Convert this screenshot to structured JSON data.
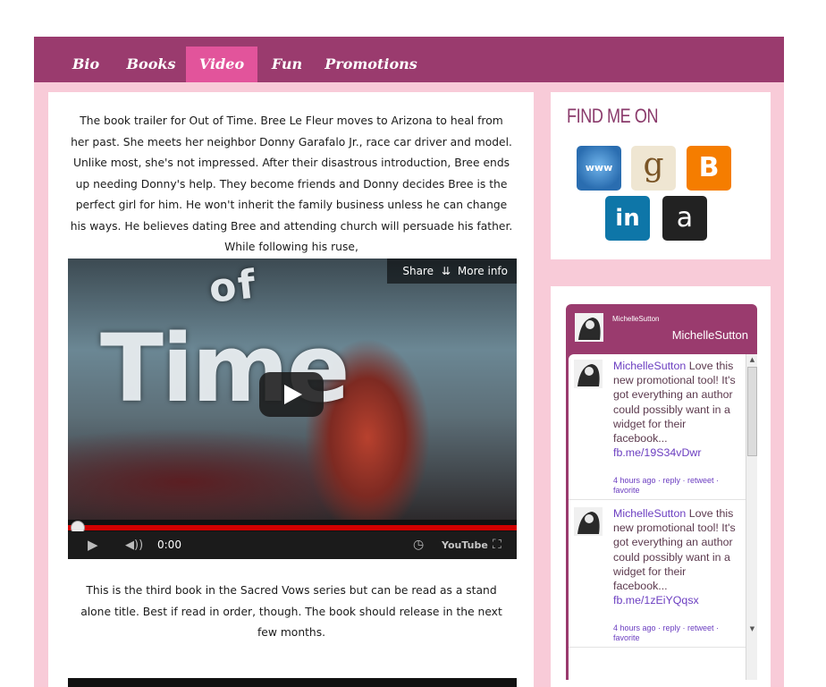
{
  "nav": {
    "items": [
      {
        "label": "Bio",
        "active": false
      },
      {
        "label": "Books",
        "active": false
      },
      {
        "label": "Video",
        "active": true
      },
      {
        "label": "Fun",
        "active": false
      },
      {
        "label": "Promotions",
        "active": false
      }
    ]
  },
  "main": {
    "intro_text": "The book trailer for Out of Time. Bree Le Fleur moves to Arizona to heal from her past. She meets her neighbor Donny Garafalo Jr., race car driver and model. Unlike most, she's not impressed. After their disastrous introduction, Bree ends up needing Donny's help. They become friends and Donny decides Bree is the perfect girl for him. He won't inherit the family business unless he can change his ways. He believes dating Bree and attending church will persuade his father. While following his ruse,",
    "video": {
      "title_line1": "of",
      "title_line2": "Time",
      "share_label": "Share",
      "more_info_label": "More info",
      "time": "0:00",
      "progress_fraction": 0.0,
      "logo_text": "YouTube"
    },
    "outro_text": "This is the third book in the Sacred Vows series but can be read as a stand alone title. Best if read in order, though. The book should release in the next few months."
  },
  "sidebar": {
    "find_title": "FIND ME ON",
    "social_icons": [
      "website-icon",
      "goodreads-icon",
      "blogger-icon",
      "linkedin-icon",
      "amazon-icon"
    ],
    "twitter": {
      "handle_small": "MichelleSutton",
      "handle_big": "MichelleSutton",
      "tweets": [
        {
          "user": "MichelleSutton",
          "text": "Love this new promotional tool! It's got everything an author could possibly want in a widget for their facebook...",
          "link": "fb.me/19S34vDwr",
          "meta": "4 hours ago · reply · retweet · favorite"
        },
        {
          "user": "MichelleSutton",
          "text": "Love this new promotional tool! It's got everything an author could possibly want in a widget for their facebook...",
          "link": "fb.me/1zEiYQqsx",
          "meta": "4 hours ago · reply · retweet · favorite"
        }
      ]
    }
  },
  "colors": {
    "nav_bg": "#9a3b6e",
    "nav_active": "#e2549b",
    "page_bg": "#f8cbd8",
    "heading": "#8a3a6b",
    "link": "#6c3fc1"
  }
}
